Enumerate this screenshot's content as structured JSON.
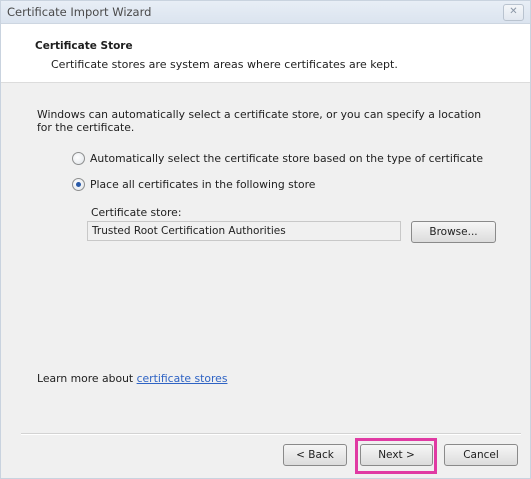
{
  "window": {
    "title": "Certificate Import Wizard",
    "close_glyph": "✕"
  },
  "header": {
    "title": "Certificate Store",
    "description": "Certificate stores are system areas where certificates are kept."
  },
  "body": {
    "intro": "Windows can automatically select a certificate store, or you can specify a location for the certificate.",
    "options": [
      {
        "label": "Automatically select the certificate store based on the type of certificate",
        "selected": false
      },
      {
        "label": "Place all certificates in the following store",
        "selected": true
      }
    ],
    "store_label": "Certificate store:",
    "store_value": "Trusted Root Certification Authorities",
    "browse_label": "Browse...",
    "learn_more_prefix": "Learn more about ",
    "learn_more_link": "certificate stores"
  },
  "footer": {
    "back_label": "< Back",
    "next_label": "Next >",
    "cancel_label": "Cancel"
  },
  "colors": {
    "highlight": "#e03aa3",
    "link": "#2e63c4"
  },
  "icons": {
    "close": "close-icon"
  }
}
